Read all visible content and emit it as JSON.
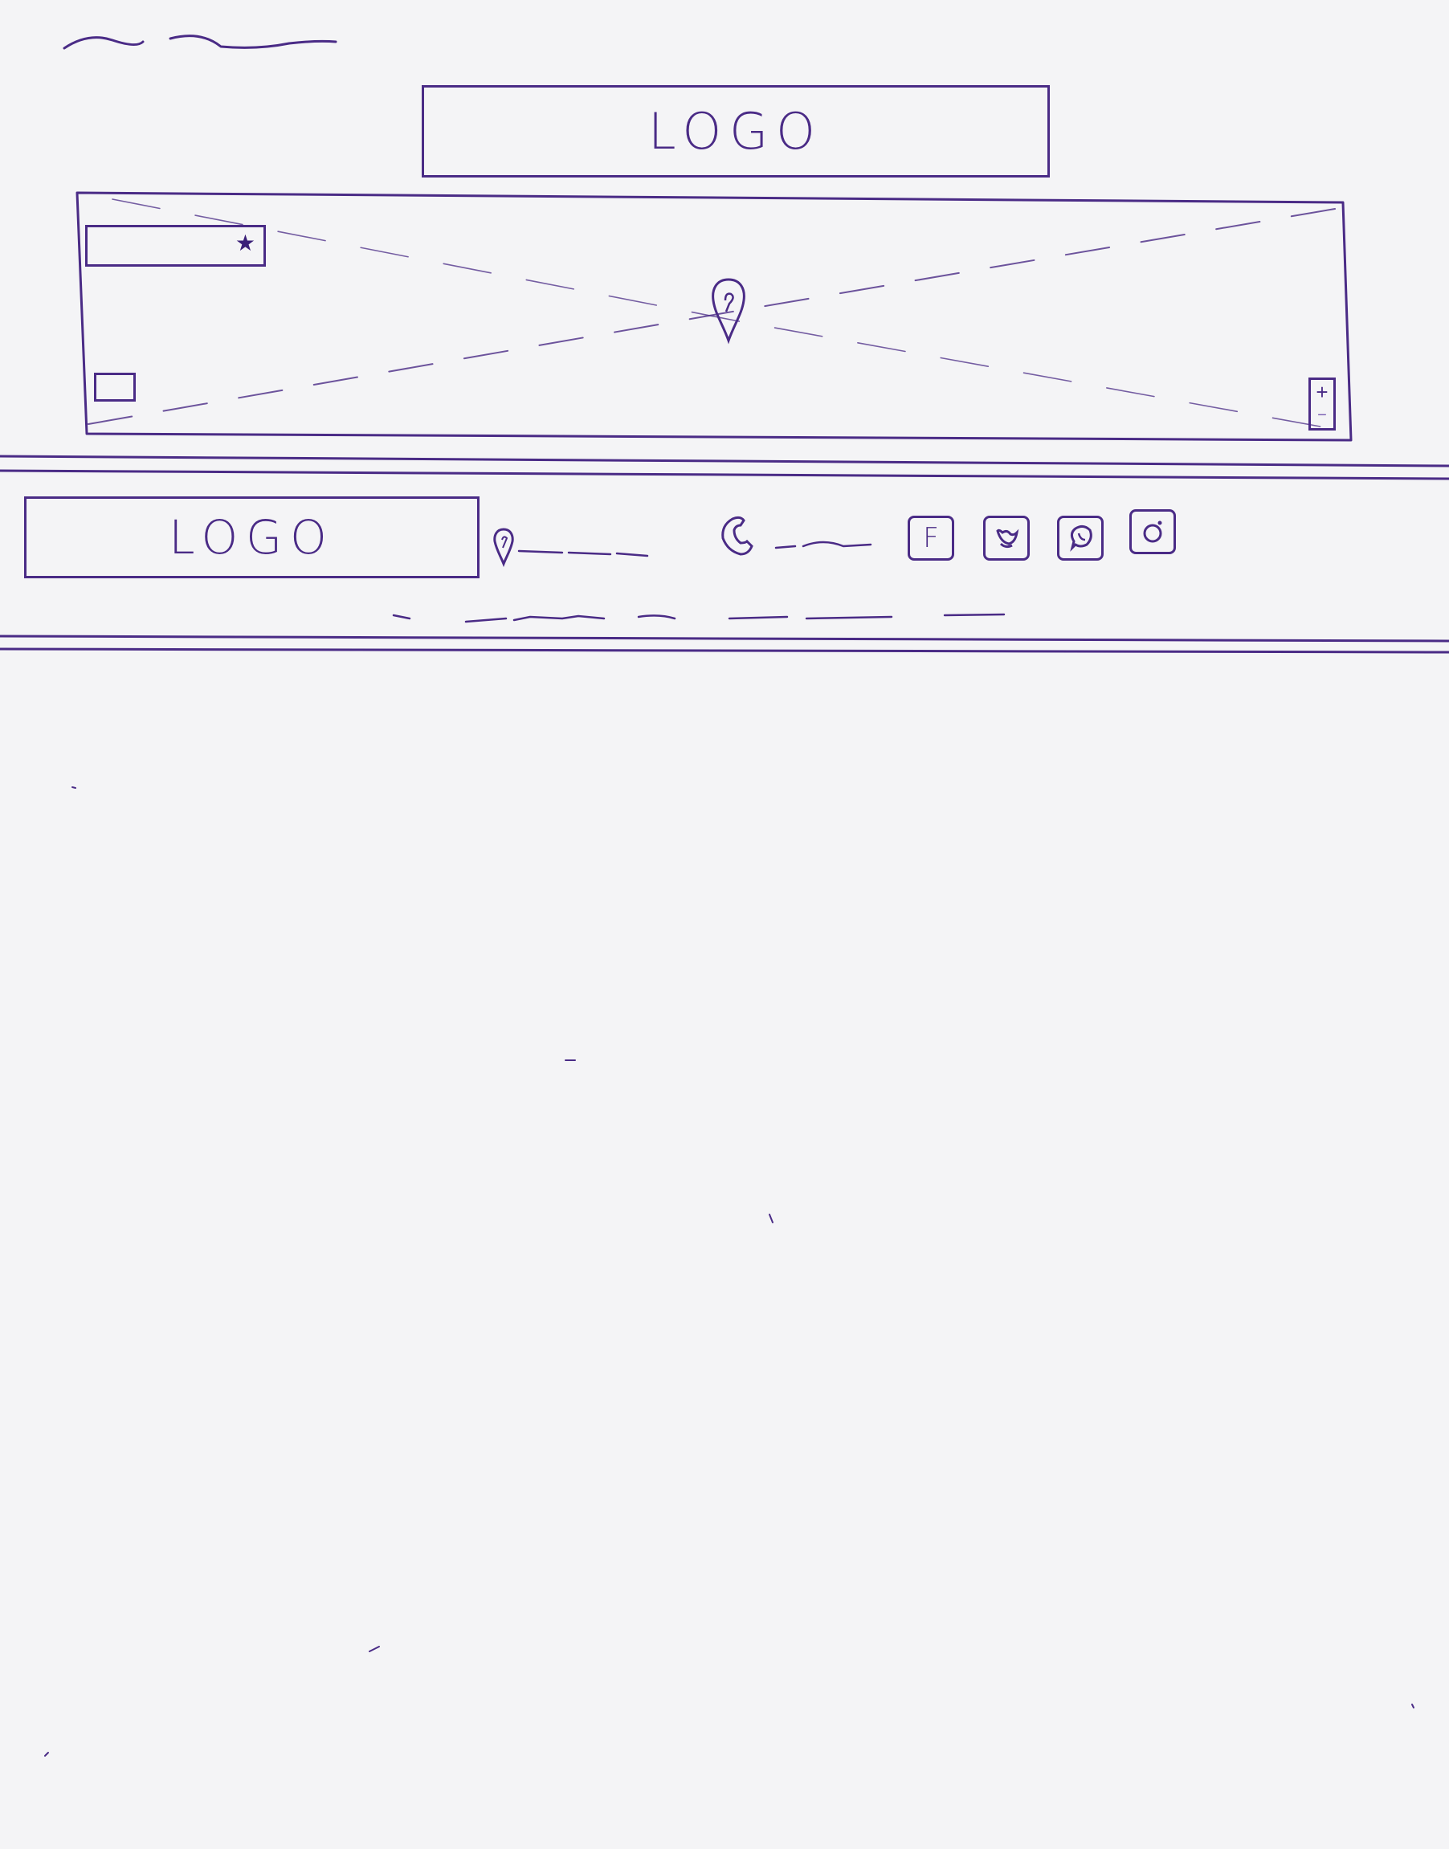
{
  "header": {
    "logo_text": "LOGO"
  },
  "map": {
    "star_glyph": "★",
    "zoom_in_label": "+",
    "zoom_out_label": "−"
  },
  "footer": {
    "logo_text": "LOGO",
    "social": {
      "facebook_letter": "F"
    }
  },
  "icons": {
    "map_pin": "map-pin-icon",
    "phone": "phone-icon",
    "facebook": "facebook-icon",
    "twitter": "twitter-icon",
    "whatsapp": "whatsapp-icon",
    "instagram": "instagram-icon"
  },
  "colors": {
    "ink": "#4a2b86",
    "paper": "#f4f4f6"
  }
}
